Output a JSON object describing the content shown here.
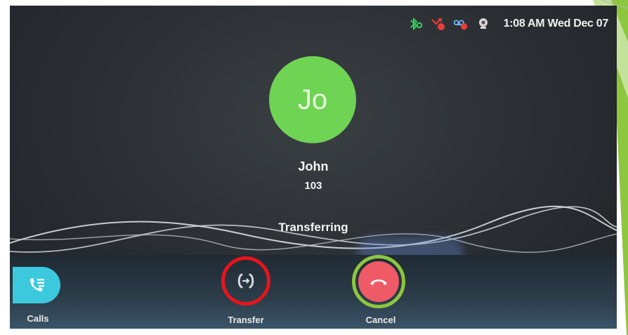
{
  "status_bar": {
    "time": "1:08 AM Wed Dec 07",
    "icons": [
      "bluetooth-icon",
      "missed-call-icon",
      "voicemail-icon",
      "webcam-icon"
    ],
    "missed_calls_badge": "2",
    "voicemail_badge": "1"
  },
  "caller": {
    "initials": "Jo",
    "name": "John",
    "number": "103",
    "avatar_color": "#6fd354"
  },
  "call": {
    "status": "Transferring"
  },
  "actions": {
    "calls_label": "Calls",
    "transfer_label": "Transfer",
    "cancel_label": "Cancel"
  },
  "colors": {
    "calls_button": "#3cc9de",
    "cancel_button": "#ef5a67",
    "transfer_highlight": "#e8141c",
    "cancel_highlight": "#8dc63f"
  }
}
